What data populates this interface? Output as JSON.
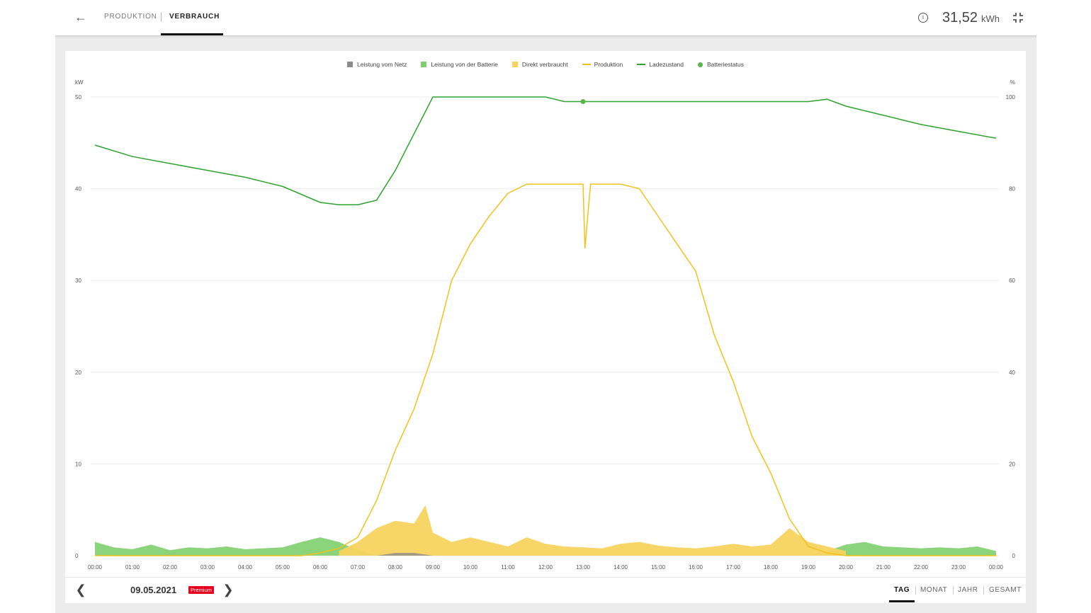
{
  "header": {
    "tabs": [
      {
        "label": "PRODUKTION",
        "active": false
      },
      {
        "label": "VERBRAUCH",
        "active": true
      }
    ],
    "total_value": "31,52",
    "total_unit": "kWh",
    "icons": {
      "back": "arrow-left-icon",
      "info": "info-circle-icon",
      "collapse": "collapse-icon"
    }
  },
  "legend": [
    {
      "label": "Leistung vom Netz",
      "color": "#8c8c8c",
      "kind": "square"
    },
    {
      "label": "Leistung von der Batterie",
      "color": "#7fcf6e",
      "kind": "square"
    },
    {
      "label": "Direkt verbraucht",
      "color": "#f7d35e",
      "kind": "square"
    },
    {
      "label": "Produktion",
      "color": "#f2c21b",
      "kind": "line"
    },
    {
      "label": "Ladezustand",
      "color": "#2ea32e",
      "kind": "line"
    },
    {
      "label": "Batteriestatus",
      "color": "#5ab54b",
      "kind": "dot"
    }
  ],
  "footer": {
    "date": "09.05.2021",
    "badge": "Premium",
    "periods": [
      "TAG",
      "MONAT",
      "JAHR",
      "GESAMT"
    ],
    "active_period": "TAG"
  },
  "chart_data": {
    "type": "line",
    "y_left_unit": "kW",
    "y_right_unit": "%",
    "y_left_ticks": [
      "0",
      "10",
      "20",
      "30",
      "40",
      "50"
    ],
    "y_right_ticks": [
      "0",
      "20",
      "40",
      "60",
      "80",
      "100"
    ],
    "ylim_left": [
      0,
      50
    ],
    "ylim_right": [
      0,
      100
    ],
    "x_ticks": [
      "00:00",
      "01:00",
      "02:00",
      "03:00",
      "04:00",
      "05:00",
      "06:00",
      "07:00",
      "08:00",
      "09:00",
      "10:00",
      "11:00",
      "12:00",
      "13:00",
      "14:00",
      "15:00",
      "16:00",
      "17:00",
      "18:00",
      "19:00",
      "20:00",
      "21:00",
      "22:00",
      "23:00",
      "00:00"
    ],
    "grid": true,
    "series": [
      {
        "name": "Produktion",
        "axis": "left",
        "x": [
          0,
          5.5,
          6,
          6.5,
          7,
          7.5,
          8,
          8.5,
          9,
          9.5,
          10,
          10.5,
          11,
          11.5,
          12,
          12.5,
          13,
          13.05,
          13.2,
          13.5,
          14,
          14.5,
          15,
          15.5,
          16,
          16.5,
          17,
          17.5,
          18,
          18.5,
          19,
          19.5,
          20,
          24
        ],
        "y": [
          0,
          0,
          0.3,
          0.8,
          2,
          6,
          11.5,
          16,
          22,
          30,
          34,
          37,
          39.5,
          40.5,
          40.5,
          40.5,
          40.5,
          33.5,
          40.5,
          40.5,
          40.5,
          40,
          37,
          34,
          31,
          24,
          19,
          13,
          9,
          4,
          1,
          0.3,
          0,
          0
        ]
      },
      {
        "name": "Ladezustand",
        "axis": "right",
        "x": [
          0,
          1,
          2,
          3,
          4,
          5,
          6,
          6.5,
          7,
          7.5,
          8,
          8.5,
          9,
          10,
          11,
          12,
          12.5,
          13,
          14,
          15,
          16,
          17,
          18,
          19,
          19.5,
          20,
          21,
          22,
          23,
          24
        ],
        "y": [
          89.5,
          87,
          85.5,
          84,
          82.5,
          80.5,
          77,
          76.5,
          76.5,
          77.5,
          84,
          92,
          100,
          100,
          100,
          100,
          99,
          99,
          99,
          99,
          99,
          99,
          99,
          99,
          99.5,
          98,
          96,
          94,
          92.5,
          91
        ]
      },
      {
        "name": "Leistung von der Batterie",
        "axis": "left",
        "x": [
          0,
          0.5,
          1,
          1.5,
          2,
          2.5,
          3,
          3.5,
          4,
          4.5,
          5,
          5.5,
          6,
          6.5,
          7,
          7.5,
          19,
          19.5,
          20,
          20.5,
          21,
          21.5,
          22,
          22.5,
          23,
          23.5,
          24
        ],
        "y": [
          1.5,
          0.9,
          0.7,
          1.2,
          0.6,
          0.9,
          0.8,
          1,
          0.7,
          0.8,
          0.9,
          1.5,
          2,
          1.5,
          0.6,
          0,
          0,
          0.5,
          1.2,
          1.5,
          1,
          0.9,
          0.8,
          0.9,
          0.8,
          1,
          0.5
        ]
      },
      {
        "name": "Direkt verbraucht",
        "axis": "left",
        "x": [
          6.5,
          7,
          7.5,
          8,
          8.5,
          8.8,
          9,
          9.5,
          10,
          10.5,
          11,
          11.5,
          12,
          12.5,
          13,
          13.5,
          14,
          14.5,
          15,
          15.5,
          16,
          16.5,
          17,
          17.5,
          18,
          18.5,
          19,
          19.5,
          20
        ],
        "y": [
          0.5,
          1.5,
          3,
          3.8,
          3.5,
          5.5,
          2.5,
          1.5,
          2,
          1.5,
          1,
          2,
          1.3,
          1,
          0.9,
          0.8,
          1.3,
          1.5,
          1.1,
          0.9,
          0.8,
          1,
          1.3,
          1,
          1.2,
          3,
          1.5,
          1,
          0.5
        ]
      },
      {
        "name": "Leistung vom Netz",
        "axis": "left",
        "x": [
          7.5,
          8,
          8.5,
          9
        ],
        "y": [
          0,
          0.3,
          0.3,
          0
        ]
      }
    ],
    "points": [
      {
        "name": "Batteriestatus",
        "x": 13,
        "y_right": 99
      }
    ]
  }
}
